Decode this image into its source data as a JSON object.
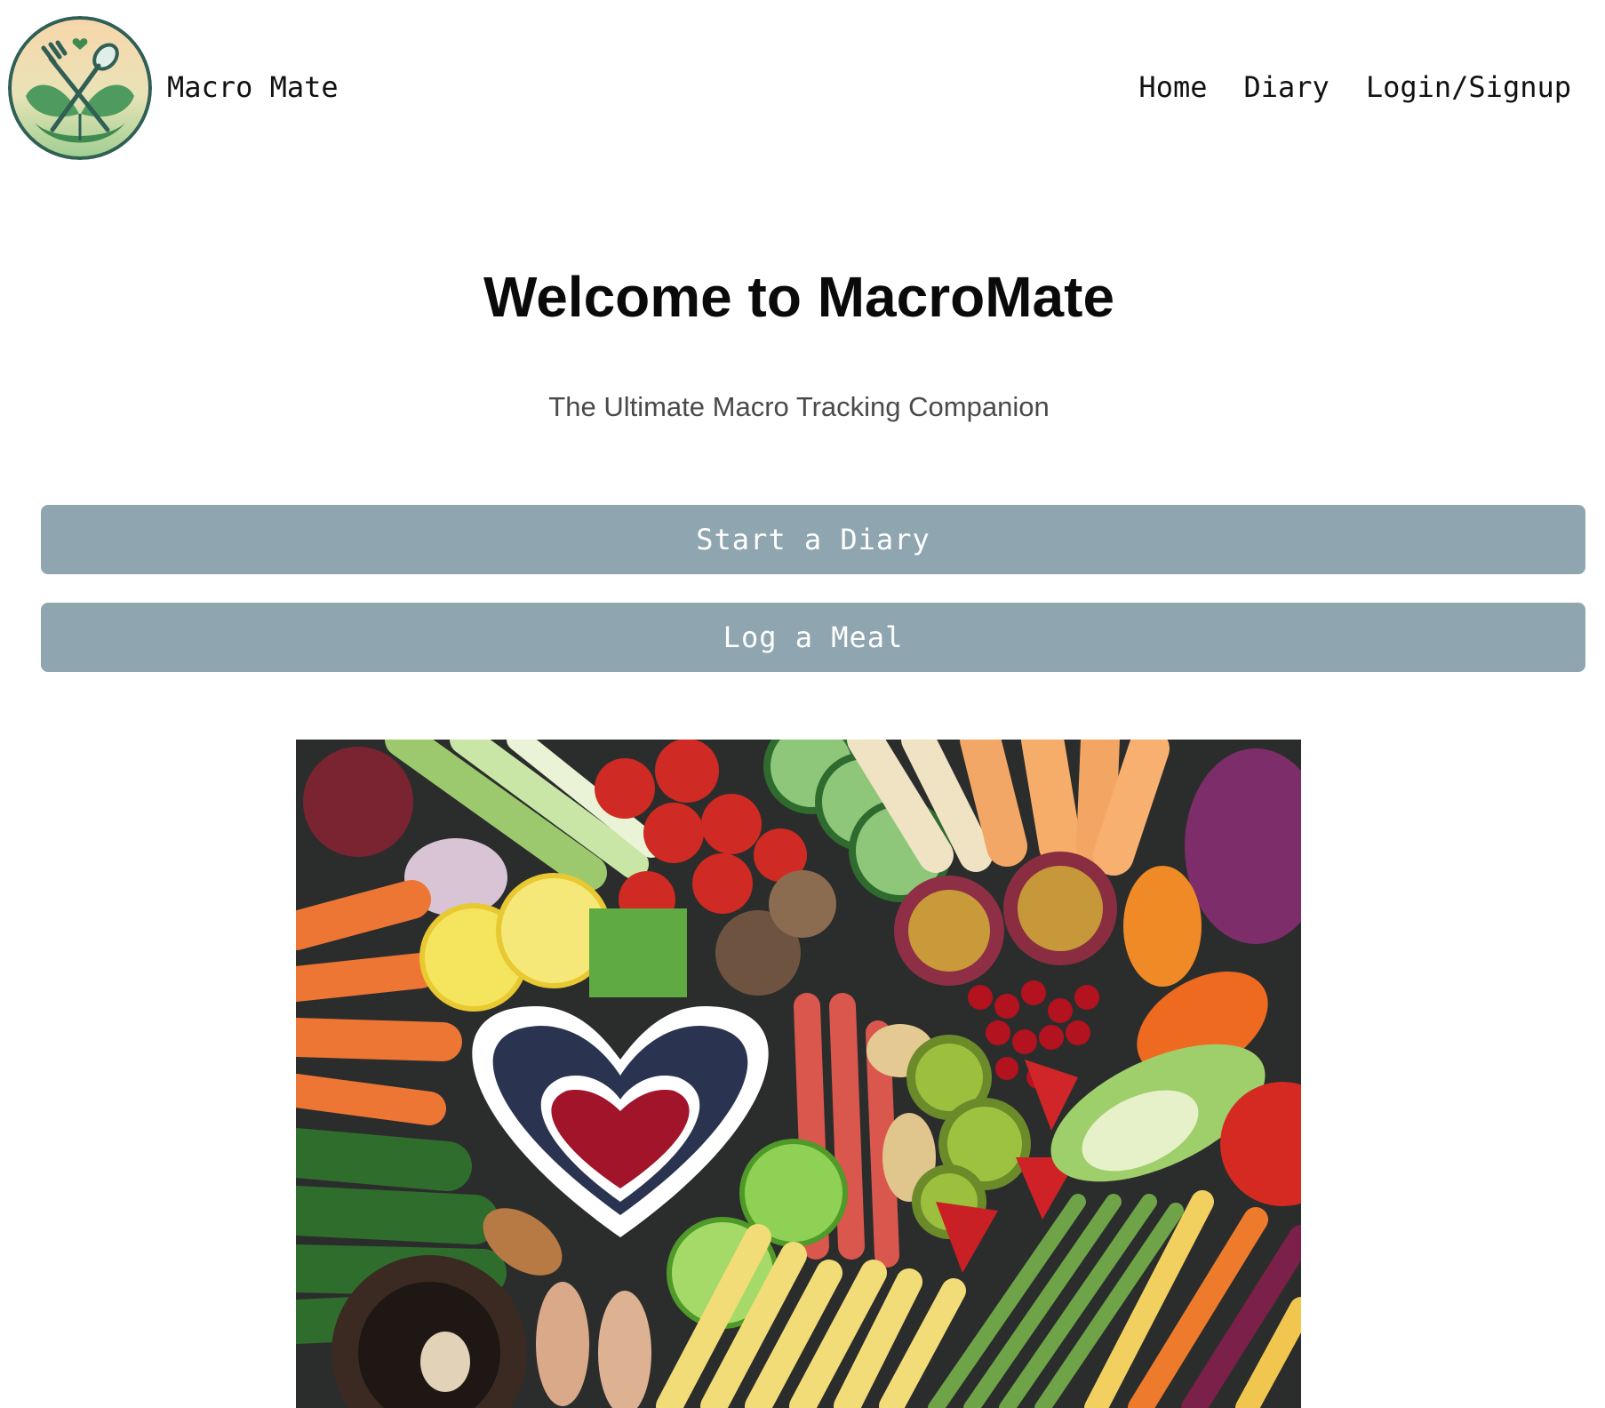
{
  "navbar": {
    "logo_icon": "fork-spoon-leaf-logo",
    "brand": "Macro Mate",
    "links": [
      {
        "label": "Home"
      },
      {
        "label": "Diary"
      },
      {
        "label": "Login/Signup"
      }
    ]
  },
  "hero": {
    "title": "Welcome to MacroMate",
    "subtitle": "The Ultimate Macro Tracking Companion",
    "buttons": [
      {
        "label": "Start a Diary"
      },
      {
        "label": "Log a Meal"
      }
    ],
    "image_subject": "healthy-vegetables-fruit-spread"
  },
  "colors": {
    "button_bg": "#8fa6b0",
    "button_text": "#ffffff",
    "subtitle_text": "#4a4a4a",
    "logo_green": "#4f9a5e",
    "logo_peach": "#f5d5a8"
  }
}
